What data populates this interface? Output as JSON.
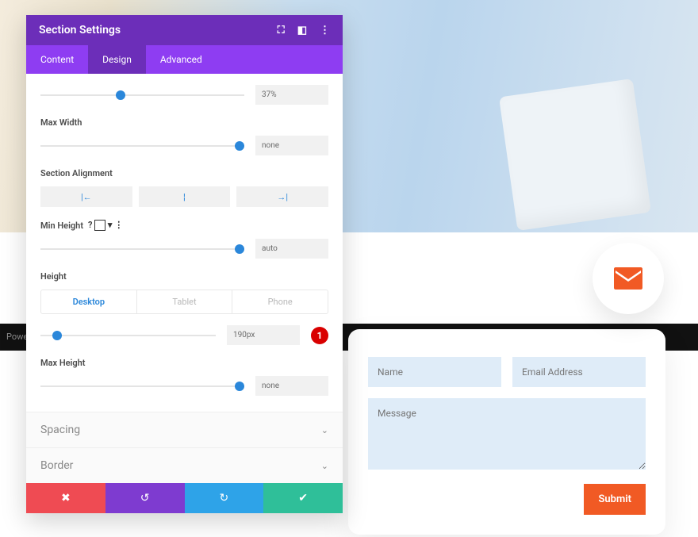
{
  "header": {
    "title": "Section Settings"
  },
  "tabs": {
    "content": "Content",
    "design": "Design",
    "advanced": "Advanced",
    "active": "design"
  },
  "controls": {
    "width": {
      "value": "37%",
      "thumb": 37
    },
    "maxWidth": {
      "label": "Max Width",
      "value": "none",
      "thumb": 100
    },
    "sectionAlign": {
      "label": "Section Alignment"
    },
    "minHeight": {
      "label": "Min Height",
      "value": "auto",
      "thumb": 100
    },
    "height": {
      "label": "Height",
      "devices": {
        "desktop": "Desktop",
        "tablet": "Tablet",
        "phone": "Phone",
        "active": "desktop"
      },
      "value": "190px",
      "thumb": 10,
      "badge": "1"
    },
    "maxHeight": {
      "label": "Max Height",
      "value": "none",
      "thumb": 100
    }
  },
  "accordion": {
    "spacing": "Spacing",
    "border": "Border"
  },
  "footerBar": "Powere",
  "contactForm": {
    "name": "Name",
    "email": "Email Address",
    "message": "Message",
    "submit": "Submit"
  },
  "colors": {
    "accent": "#f15a24",
    "panel": "#6c2eb9"
  }
}
